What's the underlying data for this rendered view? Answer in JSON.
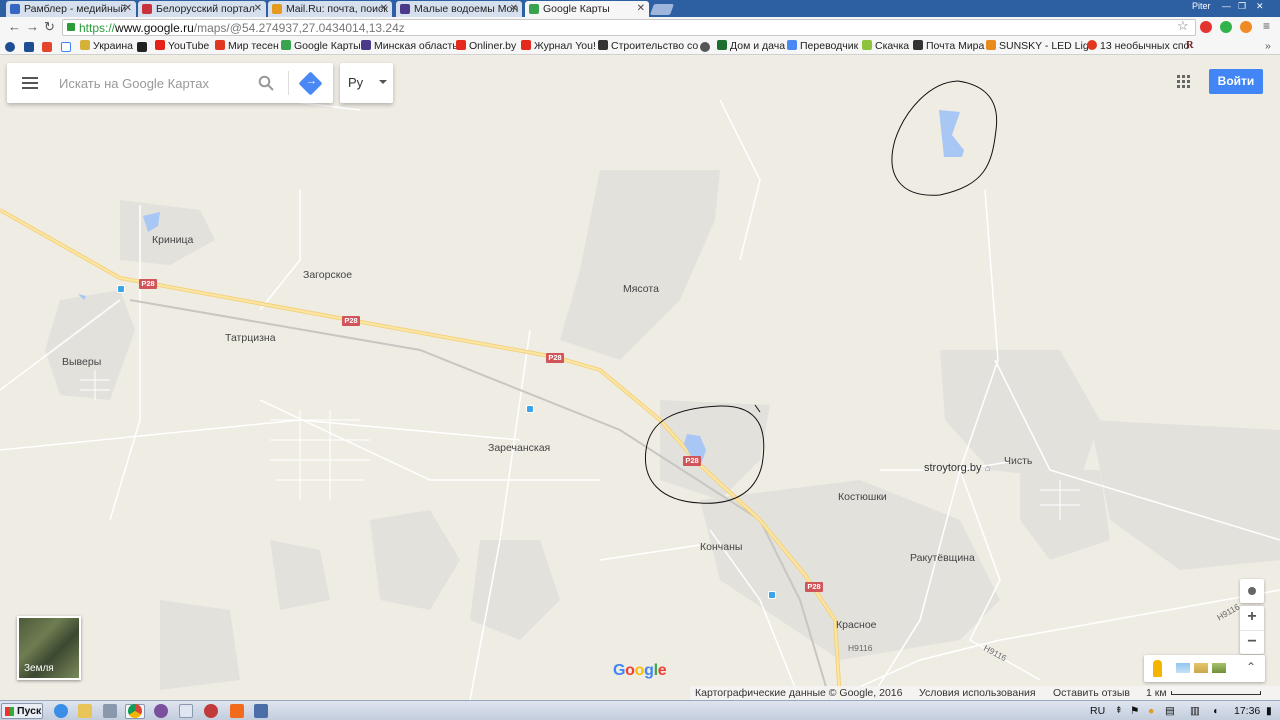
{
  "browser": {
    "tabs": [
      {
        "title": "Рамблер - медийный",
        "color": "#3466c2"
      },
      {
        "title": "Белорусский портал",
        "color": "#c8323a"
      },
      {
        "title": "Mail.Ru: почта, поиск",
        "color": "#e69a1d"
      },
      {
        "title": "Малые водоемы Мол",
        "color": "#4b3a8a"
      },
      {
        "title": "Google Карты",
        "color": "#3aa34f",
        "active": true
      }
    ],
    "user_label": "Piter",
    "url_scheme": "https://",
    "url_host": "www.google.ru",
    "url_path": "/maps/@54.274937,27.0434014,13.24z"
  },
  "bookmarks": [
    {
      "label": "Украина",
      "color": "#d5b13a"
    },
    {
      "label": "",
      "color": "#222"
    },
    {
      "label": "YouTube",
      "color": "#e62117"
    },
    {
      "label": "Мир тесен",
      "color": "#e0391f"
    },
    {
      "label": "Google Карты",
      "color": "#3aa34f"
    },
    {
      "label": "Минская область",
      "color": "#4b3a8a"
    },
    {
      "label": "Onliner.by",
      "color": "#e4291d"
    },
    {
      "label": "Журнал You!",
      "color": "#e4291d"
    },
    {
      "label": "Строительство со",
      "color": "#333"
    },
    {
      "label": "",
      "color": "#555"
    },
    {
      "label": "Дом и дача",
      "color": "#1d6f2e"
    },
    {
      "label": "Переводчик",
      "color": "#4a89f3"
    },
    {
      "label": "Скачка",
      "color": "#8ec33e"
    },
    {
      "label": "Почта Мира",
      "color": "#333"
    },
    {
      "label": "SUNSKY - LED Ligl",
      "color": "#e88b1a"
    },
    {
      "label": "13 необычных спо",
      "color": "#e0391f"
    },
    {
      "label": "",
      "color": "#6a2222"
    }
  ],
  "search": {
    "placeholder": "Искать на Google Картах",
    "language": "Ру",
    "signin_label": "Войти"
  },
  "map": {
    "places": [
      {
        "name": "Криница"
      },
      {
        "name": "Загорское"
      },
      {
        "name": "Мясота"
      },
      {
        "name": "Татрцизна"
      },
      {
        "name": "Выверы"
      },
      {
        "name": "Заречанская"
      },
      {
        "name": "Костюшки"
      },
      {
        "name": "Кончаны"
      },
      {
        "name": "Ракутёвщина"
      },
      {
        "name": "Красное"
      },
      {
        "name": "stroytorg.by"
      },
      {
        "name": "Чисть"
      }
    ],
    "road_shield": "P28",
    "road_labels": [
      "H9116",
      "H9116",
      "H9116"
    ],
    "earth_label": "Земля",
    "logo": "Google",
    "footer": {
      "copyright": "Картографические данные © Google, 2016",
      "terms": "Условия использования",
      "feedback": "Оставить отзыв",
      "scale": "1 км"
    }
  },
  "taskbar": {
    "start_label": "Пуск",
    "lang": "RU",
    "clock": "17:36"
  }
}
